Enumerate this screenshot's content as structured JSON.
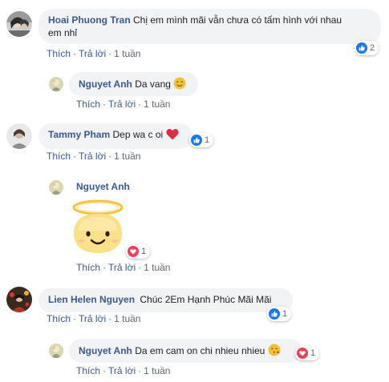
{
  "colors": {
    "link": "#385898",
    "meta": "#606770",
    "bubble": "#f2f3f5",
    "like": "#1877f2",
    "love": "#f33e58"
  },
  "comments": [
    {
      "author": "Hoai Phuong Tran",
      "text_line1": "Chị em mình mãi vẫn chưa có tấm hình với nhau",
      "text_line2": "em nhỉ",
      "like": "Thích",
      "reply": "Trả lời",
      "time": "1 tuần",
      "reaction_icon": "like-icon",
      "reaction_count": "2"
    },
    {
      "author": "Nguyet Anh",
      "text": "Da vang",
      "emoji": "smiling-emoji-icon",
      "like": "Thích",
      "reply": "Trả lời",
      "time": "1 tuần"
    },
    {
      "author": "Tammy Pham",
      "text": "Dep wa c oi",
      "emoji": "red-heart-emoji-icon",
      "like": "Thích",
      "reply": "Trả lời",
      "time": "1 tuần",
      "reaction_icon": "like-icon",
      "reaction_count": "1"
    },
    {
      "author": "Nguyet Anh",
      "sticker": "angel-sticker-icon",
      "like": "Thích",
      "reply": "Trả lời",
      "time": "1 tuần",
      "reaction_icon": "love-icon",
      "reaction_count": "1"
    },
    {
      "author": "Lien Helen Nguyen",
      "text": "Chúc 2Em Hạnh Phúc Mãi Mãi",
      "like": "Thích",
      "reply": "Trả lời",
      "time": "1 tuần",
      "reaction_icon": "like-icon",
      "reaction_count": "1"
    },
    {
      "author": "Nguyet Anh",
      "text": "Da em cam on chi nhieu nhieu",
      "emoji": "kiss-emoji-icon",
      "like": "Thích",
      "reply": "Trả lời",
      "time": "1 tuần",
      "reaction_icon": "love-icon",
      "reaction_count": "1"
    }
  ]
}
